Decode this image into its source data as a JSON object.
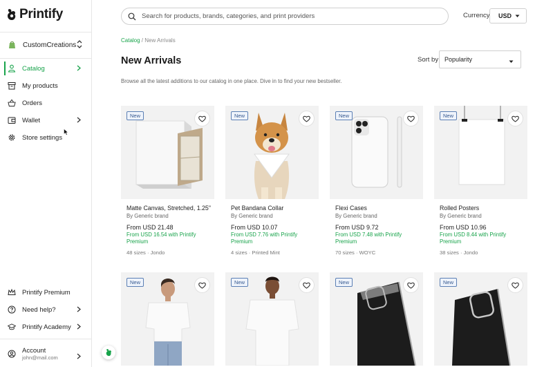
{
  "brand": {
    "name": "Printify"
  },
  "store": {
    "name": "CustomCreations"
  },
  "nav": [
    {
      "label": "Catalog",
      "icon": "person-icon"
    },
    {
      "label": "My products",
      "icon": "archive-icon"
    },
    {
      "label": "Orders",
      "icon": "basket-icon"
    },
    {
      "label": "Wallet",
      "icon": "wallet-icon"
    },
    {
      "label": "Store settings",
      "icon": "gear-icon"
    }
  ],
  "bottom_nav": [
    {
      "label": "Printify Premium",
      "icon": "crown-icon"
    },
    {
      "label": "Need help?",
      "icon": "help-icon"
    },
    {
      "label": "Printify Academy",
      "icon": "academy-icon"
    }
  ],
  "account": {
    "label": "Account",
    "email": "john@mail.com"
  },
  "search": {
    "placeholder": "Search for products, brands, categories, and print providers"
  },
  "currency": {
    "label": "Currency",
    "value": "USD"
  },
  "breadcrumb": {
    "root": "Catalog",
    "sep": " / ",
    "current": "New Arrivals"
  },
  "page": {
    "title": "New Arrivals",
    "description": "Browse all the latest additions to our catalog in one place. Dive in to find your new bestseller."
  },
  "sort": {
    "label": "Sort by",
    "value": "Popularity"
  },
  "badge_label": "New",
  "products": [
    {
      "name": "Matte Canvas, Stretched, 1.25\"",
      "brand": "By Generic brand",
      "price": "From USD 21.48",
      "premium": "From USD 16.54 with Printify Premium",
      "meta": "48 sizes · Jondo"
    },
    {
      "name": "Pet Bandana Collar",
      "brand": "By Generic brand",
      "price": "From USD 10.07",
      "premium": "From USD 7.76 with Printify Premium",
      "meta": "4 sizes · Printed Mint"
    },
    {
      "name": "Flexi Cases",
      "brand": "By Generic brand",
      "price": "From USD 9.72",
      "premium": "From USD 7.48 with Printify Premium",
      "meta": "70 sizes · WOYC"
    },
    {
      "name": "Rolled Posters",
      "brand": "By Generic brand",
      "price": "From USD 10.96",
      "premium": "From USD 8.44 with Printify Premium",
      "meta": "38 sizes · Jondo"
    }
  ],
  "colors": {
    "accent": "#17a34a",
    "badge_border": "#5b7fb4"
  }
}
